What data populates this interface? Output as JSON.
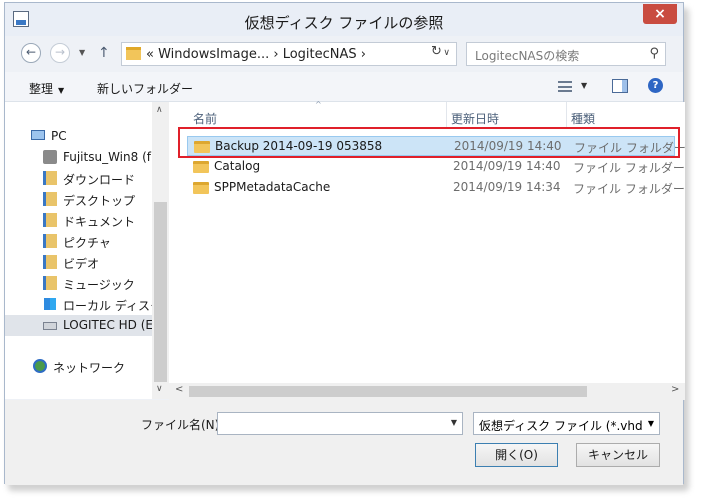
{
  "window": {
    "title": "仮想ディスク ファイルの参照",
    "close_label": "×"
  },
  "nav": {
    "back_glyph": "←",
    "forward_glyph": "→",
    "dropdown_glyph": "▼",
    "up_glyph": "↑",
    "address_text": "«  WindowsImage...  ›  LogitecNAS  ›",
    "address_dropdown_glyph": "∨",
    "refresh_glyph": "↻",
    "search_placeholder": "LogitecNASの検索",
    "search_glyph": "⚲"
  },
  "toolbar": {
    "organize_label": "整理",
    "organize_caret": "▼",
    "new_folder_label": "新しいフォルダー",
    "view_caret": "▼",
    "help_glyph": "?"
  },
  "sidebar": {
    "items": [
      {
        "label": "PC",
        "icon": "pc-icon"
      },
      {
        "label": "Fujitsu_Win8 (f",
        "icon": "user-folder-icon"
      },
      {
        "label": "ダウンロード",
        "icon": "library-icon"
      },
      {
        "label": "デスクトップ",
        "icon": "library-icon"
      },
      {
        "label": "ドキュメント",
        "icon": "library-icon"
      },
      {
        "label": "ピクチャ",
        "icon": "library-icon"
      },
      {
        "label": "ビデオ",
        "icon": "library-icon"
      },
      {
        "label": "ミュージック",
        "icon": "library-icon"
      },
      {
        "label": "ローカル ディスク (C",
        "icon": "windows-drive-icon"
      },
      {
        "label": "LOGITEC HD (E",
        "icon": "drive-icon"
      },
      {
        "label": "ネットワーク",
        "icon": "network-icon"
      }
    ],
    "scroll_up_glyph": "∧",
    "scroll_down_glyph": "∨"
  },
  "file_list": {
    "sort_glyph": "^",
    "columns": {
      "name": "名前",
      "date": "更新日時",
      "type": "種類"
    },
    "rows": [
      {
        "name": "Backup 2014-09-19 053858",
        "date": "2014/09/19 14:40",
        "type": "ファイル フォルダー",
        "selected": true
      },
      {
        "name": "Catalog",
        "date": "2014/09/19 14:40",
        "type": "ファイル フォルダー",
        "selected": false
      },
      {
        "name": "SPPMetadataCache",
        "date": "2014/09/19 14:34",
        "type": "ファイル フォルダー",
        "selected": false
      }
    ],
    "hscroll_left_glyph": "<",
    "hscroll_right_glyph": ">"
  },
  "footer": {
    "filename_label": "ファイル名(N):",
    "filename_value": "",
    "filename_dropdown_glyph": "▼",
    "filetype_value": "仮想ディスク ファイル (*.vhd、*.vl",
    "filetype_dropdown_glyph": "▼",
    "open_label": "開く(O)",
    "cancel_label": "キャンセル"
  },
  "colors": {
    "highlight_border": "#e0202a",
    "selection_bg": "#cce4f7",
    "close_button": "#c94c40"
  }
}
